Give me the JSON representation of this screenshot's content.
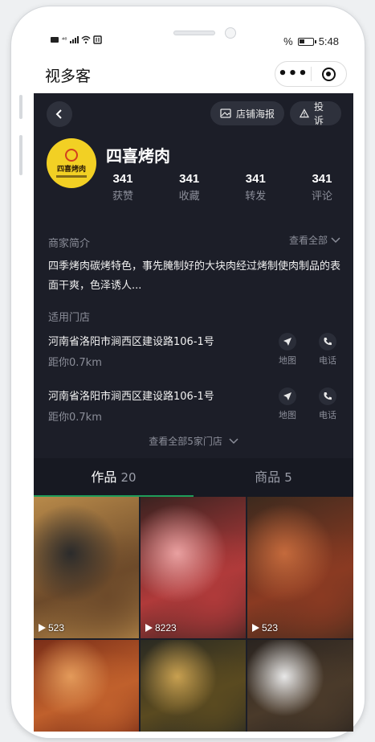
{
  "status_bar": {
    "left_text": "⁴⁶",
    "battery_percent_label": "%",
    "time": "5:48"
  },
  "app_bar": {
    "title": "视多客",
    "more_label": "•••"
  },
  "header": {
    "poster_label": "店铺海报",
    "report_label": "投诉",
    "logo_text": "四喜烤肉",
    "shop_name": "四喜烤肉",
    "stats": [
      {
        "value": "341",
        "label": "获赞"
      },
      {
        "value": "341",
        "label": "收藏"
      },
      {
        "value": "341",
        "label": "转发"
      },
      {
        "value": "341",
        "label": "评论"
      }
    ]
  },
  "intro": {
    "label": "商家简介",
    "see_all": "查看全部",
    "text": "四季烤肉碳烤特色，事先腌制好的大块肉经过烤制使肉制品的表面干爽，色泽诱人..."
  },
  "stores": {
    "label": "适用门店",
    "items": [
      {
        "address": "河南省洛阳市涧西区建设路106-1号",
        "distance": "距你0.7km",
        "map_label": "地图",
        "phone_label": "电话"
      },
      {
        "address": "河南省洛阳市涧西区建设路106-1号",
        "distance": "距你0.7km",
        "map_label": "地图",
        "phone_label": "电话"
      }
    ],
    "see_all": "查看全部5家门店"
  },
  "tabs": [
    {
      "label": "作品",
      "count": "20",
      "active": true
    },
    {
      "label": "商品",
      "count": "5",
      "active": false
    }
  ],
  "videos": [
    {
      "plays": "523",
      "colors": [
        "#6d4a2a",
        "#2b2b2b",
        "#b88a4a"
      ]
    },
    {
      "plays": "8223",
      "colors": [
        "#b03a3a",
        "#e9a0a0",
        "#3a2220"
      ]
    },
    {
      "plays": "523",
      "colors": [
        "#8a3a22",
        "#c46a3c",
        "#3d2a1e"
      ]
    },
    {
      "plays": "",
      "colors": [
        "#c0602c",
        "#e39a5a",
        "#7a2e18"
      ]
    },
    {
      "plays": "",
      "colors": [
        "#5a4a20",
        "#c8a050",
        "#2a2a22"
      ]
    },
    {
      "plays": "",
      "colors": [
        "#4a3a2a",
        "#e8e8e8",
        "#2a2420"
      ]
    }
  ],
  "colors": {
    "screen_bg": "#1c1e28",
    "accent_green": "#1f9d5a",
    "logo_bg": "#f2d024"
  }
}
